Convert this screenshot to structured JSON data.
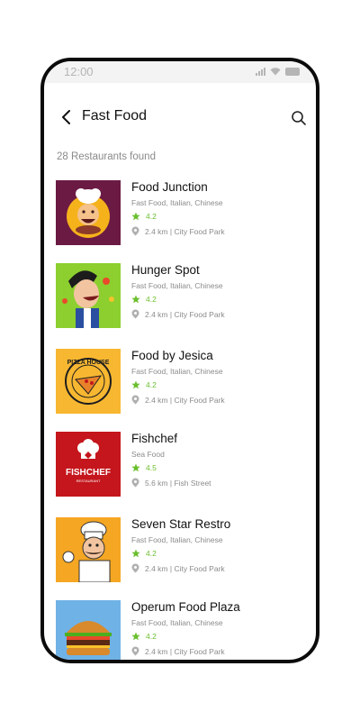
{
  "status": {
    "time": "12:00"
  },
  "header": {
    "title": "Fast Food"
  },
  "results": {
    "count_text": "28 Restaurants found"
  },
  "theme": {
    "rating_color": "#6abf2d"
  },
  "restaurants": [
    {
      "name": "Food Junction",
      "cuisine": "Fast Food, Italian, Chinese",
      "rating": "4.2",
      "location": "2.4 km  |  City Food Park",
      "thumb_bg": "#6b1a44",
      "logo": "chef-eating-logo"
    },
    {
      "name": "Hunger Spot",
      "cuisine": "Fast Food, Italian, Chinese",
      "rating": "4.2",
      "location": "2.4 km  |  City Food Park",
      "thumb_bg": "#8ccf2e",
      "logo": "hungry-man-logo"
    },
    {
      "name": "Food by Jesica",
      "cuisine": "Fast Food, Italian, Chinese",
      "rating": "4.2",
      "location": "2.4 km  |  City Food Park",
      "thumb_bg": "#f7b731",
      "logo": "pizza-house-logo",
      "logo_text": "PIZZA HOUSE"
    },
    {
      "name": "Fishchef",
      "cuisine": "Sea Food",
      "rating": "4.5",
      "location": "5.6 km  |  Fish Street",
      "thumb_bg": "#c4161c",
      "logo": "fishchef-logo",
      "logo_text": "FISHCHEF",
      "logo_subtext": "RESTAURANT"
    },
    {
      "name": "Seven Star Restro",
      "cuisine": "Fast Food, Italian, Chinese",
      "rating": "4.2",
      "location": "2.4 km  |  City Food Park",
      "thumb_bg": "#f5a623",
      "logo": "chef-mascot-logo"
    },
    {
      "name": "Operum Food Plaza",
      "cuisine": "Fast Food, Italian, Chinese",
      "rating": "4.2",
      "location": "2.4 km  |  City Food Park",
      "thumb_bg": "#6fb2e6",
      "logo": "burger-logo"
    }
  ]
}
